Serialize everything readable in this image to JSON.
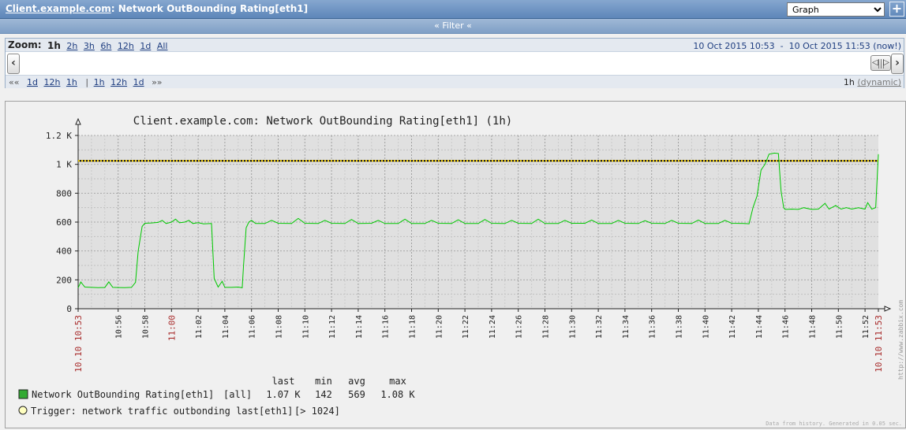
{
  "header": {
    "host": "Client.example.com",
    "title_rest": ": Network OutBounding Rating[eth1]",
    "view_select": "Graph",
    "add_label": "+"
  },
  "filter": {
    "label": "« Filter «"
  },
  "zoom": {
    "label": "Zoom:",
    "options": [
      "1h",
      "2h",
      "3h",
      "6h",
      "12h",
      "1d",
      "All"
    ],
    "active": "1h",
    "period_from": "10 Oct 2015 10:53",
    "period_sep": "-",
    "period_to": "10 Oct 2015 11:53",
    "now_label": "(now!)"
  },
  "nav": {
    "back_prefix": "««",
    "back_links": [
      "1d",
      "12h",
      "1h"
    ],
    "divider": "|",
    "fwd_links": [
      "1h",
      "12h",
      "1d"
    ],
    "fwd_suffix": "»»",
    "period": "1h",
    "mode": "(dynamic)"
  },
  "graph": {
    "title": "Client.example.com: Network OutBounding Rating[eth1] (1h)",
    "watermark": "http://www.zabbix.com",
    "footer": "Data from history. Generated in 0.05 sec.",
    "legend_headers": [
      "last",
      "min",
      "avg",
      "max"
    ],
    "item_name": "Network OutBounding Rating[eth1]",
    "item_func": "[all]",
    "item_values": [
      "1.07 K",
      "142",
      "569",
      "1.08 K"
    ],
    "trigger_label": "Trigger: network traffic outbonding last[eth1]",
    "trigger_cond": "[> 1024]"
  },
  "chart_data": {
    "type": "line",
    "title": "Client.example.com: Network OutBounding Rating[eth1] (1h)",
    "ylim": [
      0,
      1200
    ],
    "yticks": [
      {
        "v": 0,
        "label": "0"
      },
      {
        "v": 200,
        "label": "200"
      },
      {
        "v": 400,
        "label": "400"
      },
      {
        "v": 600,
        "label": "600"
      },
      {
        "v": 800,
        "label": "800"
      },
      {
        "v": 1000,
        "label": "1 K"
      },
      {
        "v": 1200,
        "label": "1.2 K"
      }
    ],
    "xlim_minutes": [
      0,
      60
    ],
    "xticks": [
      {
        "m": 0,
        "label": "10.10 10:53",
        "red": true
      },
      {
        "m": 3,
        "label": "10:56"
      },
      {
        "m": 5,
        "label": "10:58"
      },
      {
        "m": 7,
        "label": "11:00",
        "red": true
      },
      {
        "m": 9,
        "label": "11:02"
      },
      {
        "m": 11,
        "label": "11:04"
      },
      {
        "m": 13,
        "label": "11:06"
      },
      {
        "m": 15,
        "label": "11:08"
      },
      {
        "m": 17,
        "label": "11:10"
      },
      {
        "m": 19,
        "label": "11:12"
      },
      {
        "m": 21,
        "label": "11:14"
      },
      {
        "m": 23,
        "label": "11:16"
      },
      {
        "m": 25,
        "label": "11:18"
      },
      {
        "m": 27,
        "label": "11:20"
      },
      {
        "m": 29,
        "label": "11:22"
      },
      {
        "m": 31,
        "label": "11:24"
      },
      {
        "m": 33,
        "label": "11:26"
      },
      {
        "m": 35,
        "label": "11:28"
      },
      {
        "m": 37,
        "label": "11:30"
      },
      {
        "m": 39,
        "label": "11:32"
      },
      {
        "m": 41,
        "label": "11:34"
      },
      {
        "m": 43,
        "label": "11:36"
      },
      {
        "m": 45,
        "label": "11:38"
      },
      {
        "m": 47,
        "label": "11:40"
      },
      {
        "m": 49,
        "label": "11:42"
      },
      {
        "m": 51,
        "label": "11:44"
      },
      {
        "m": 53,
        "label": "11:46"
      },
      {
        "m": 55,
        "label": "11:48"
      },
      {
        "m": 57,
        "label": "11:50"
      },
      {
        "m": 59,
        "label": "11:52"
      },
      {
        "m": 60,
        "label": "10.10 11:53",
        "red": true
      }
    ],
    "series": [
      {
        "name": "Network OutBounding Rating[eth1]",
        "color": "#00c800",
        "points": [
          [
            0,
            145
          ],
          [
            0.2,
            185
          ],
          [
            0.5,
            150
          ],
          [
            1,
            148
          ],
          [
            1.5,
            146
          ],
          [
            2,
            147
          ],
          [
            2.3,
            186
          ],
          [
            2.6,
            148
          ],
          [
            3,
            147
          ],
          [
            3.5,
            146
          ],
          [
            4,
            148
          ],
          [
            4.3,
            182
          ],
          [
            4.5,
            400
          ],
          [
            4.8,
            570
          ],
          [
            5,
            592
          ],
          [
            5.5,
            594
          ],
          [
            6,
            598
          ],
          [
            6.3,
            612
          ],
          [
            6.6,
            590
          ],
          [
            7,
            600
          ],
          [
            7.3,
            620
          ],
          [
            7.6,
            595
          ],
          [
            8,
            600
          ],
          [
            8.3,
            612
          ],
          [
            8.6,
            590
          ],
          [
            9,
            596
          ],
          [
            9.4,
            588
          ],
          [
            10,
            590
          ],
          [
            10.2,
            210
          ],
          [
            10.5,
            150
          ],
          [
            10.8,
            190
          ],
          [
            11,
            148
          ],
          [
            11.5,
            148
          ],
          [
            12,
            150
          ],
          [
            12.3,
            145
          ],
          [
            12.4,
            300
          ],
          [
            12.6,
            560
          ],
          [
            12.8,
            600
          ],
          [
            13,
            612
          ],
          [
            13.3,
            590
          ],
          [
            14,
            590
          ],
          [
            14.5,
            612
          ],
          [
            15,
            592
          ],
          [
            16,
            590
          ],
          [
            16.5,
            625
          ],
          [
            17,
            592
          ],
          [
            18,
            590
          ],
          [
            18.5,
            612
          ],
          [
            19,
            592
          ],
          [
            20,
            590
          ],
          [
            20.5,
            618
          ],
          [
            21,
            590
          ],
          [
            22,
            592
          ],
          [
            22.5,
            612
          ],
          [
            23,
            590
          ],
          [
            24,
            590
          ],
          [
            24.5,
            620
          ],
          [
            25,
            590
          ],
          [
            26,
            590
          ],
          [
            26.5,
            612
          ],
          [
            27,
            592
          ],
          [
            28,
            590
          ],
          [
            28.5,
            616
          ],
          [
            29,
            590
          ],
          [
            30,
            590
          ],
          [
            30.5,
            618
          ],
          [
            31,
            592
          ],
          [
            32,
            590
          ],
          [
            32.5,
            612
          ],
          [
            33,
            592
          ],
          [
            34,
            590
          ],
          [
            34.5,
            620
          ],
          [
            35,
            590
          ],
          [
            36,
            590
          ],
          [
            36.5,
            612
          ],
          [
            37,
            592
          ],
          [
            38,
            592
          ],
          [
            38.5,
            614
          ],
          [
            39,
            590
          ],
          [
            40,
            590
          ],
          [
            40.5,
            612
          ],
          [
            41,
            592
          ],
          [
            42,
            590
          ],
          [
            42.5,
            610
          ],
          [
            43,
            592
          ],
          [
            44,
            590
          ],
          [
            44.5,
            612
          ],
          [
            45,
            592
          ],
          [
            46,
            590
          ],
          [
            46.5,
            614
          ],
          [
            47,
            590
          ],
          [
            48,
            590
          ],
          [
            48.5,
            612
          ],
          [
            49,
            592
          ],
          [
            50,
            590
          ],
          [
            50.3,
            588
          ],
          [
            50.6,
            700
          ],
          [
            50.9,
            780
          ],
          [
            51.2,
            960
          ],
          [
            51.5,
            1000
          ],
          [
            51.8,
            1070
          ],
          [
            52.2,
            1078
          ],
          [
            52.5,
            1075
          ],
          [
            52.7,
            820
          ],
          [
            52.9,
            700
          ],
          [
            53,
            688
          ],
          [
            53.5,
            690
          ],
          [
            54,
            688
          ],
          [
            54.4,
            700
          ],
          [
            55,
            688
          ],
          [
            55.5,
            690
          ],
          [
            56,
            730
          ],
          [
            56.3,
            690
          ],
          [
            56.8,
            715
          ],
          [
            57.2,
            690
          ],
          [
            57.6,
            700
          ],
          [
            58,
            690
          ],
          [
            58.5,
            700
          ],
          [
            59,
            690
          ],
          [
            59.2,
            735
          ],
          [
            59.5,
            690
          ],
          [
            59.8,
            700
          ],
          [
            60,
            1070
          ]
        ]
      }
    ],
    "threshold": {
      "value": 1024,
      "color": "#ffd700",
      "label": "Trigger: network traffic outbonding last[eth1]"
    }
  }
}
